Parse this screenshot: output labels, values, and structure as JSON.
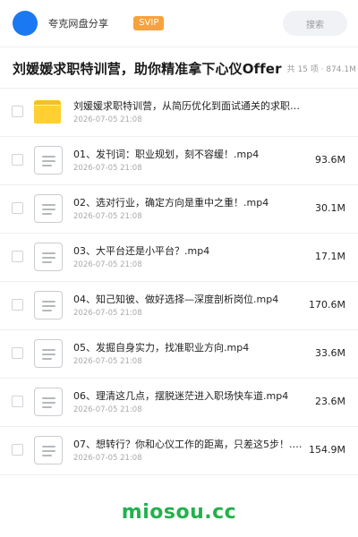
{
  "header": {
    "app_name": "夸克网盘分享",
    "badge": "SVIP",
    "search_placeholder": "搜索"
  },
  "page": {
    "title": "刘媛媛求职特训营，助你精准拿下心仪Offer",
    "meta": "共 15 项 · 874.1M"
  },
  "files": [
    {
      "type": "folder",
      "name": "刘媛媛求职特训营，从简历优化到面试通关的求职指南",
      "date": "2026-07-05 21:08",
      "size": ""
    },
    {
      "type": "video",
      "name": "01、发刊词：职业规划，刻不容缓！.mp4",
      "date": "2026-07-05 21:08",
      "size": "93.6M"
    },
    {
      "type": "video",
      "name": "02、选对行业，确定方向是重中之重！.mp4",
      "date": "2026-07-05 21:08",
      "size": "30.1M"
    },
    {
      "type": "video",
      "name": "03、大平台还是小平台？.mp4",
      "date": "2026-07-05 21:08",
      "size": "17.1M"
    },
    {
      "type": "video",
      "name": "04、知己知彼、做好选择—深度剖析岗位.mp4",
      "date": "2026-07-05 21:08",
      "size": "170.6M"
    },
    {
      "type": "video",
      "name": "05、发掘自身实力，找准职业方向.mp4",
      "date": "2026-07-05 21:08",
      "size": "33.6M"
    },
    {
      "type": "video",
      "name": "06、理清这几点，摆脱迷茫进入职场快车道.mp4",
      "date": "2026-07-05 21:08",
      "size": "23.6M"
    },
    {
      "type": "video",
      "name": "07、想转行？你和心仪工作的距离，只差这5步！.m…",
      "date": "2026-07-05 21:08",
      "size": "154.9M"
    }
  ],
  "watermark": "miosou.cc"
}
